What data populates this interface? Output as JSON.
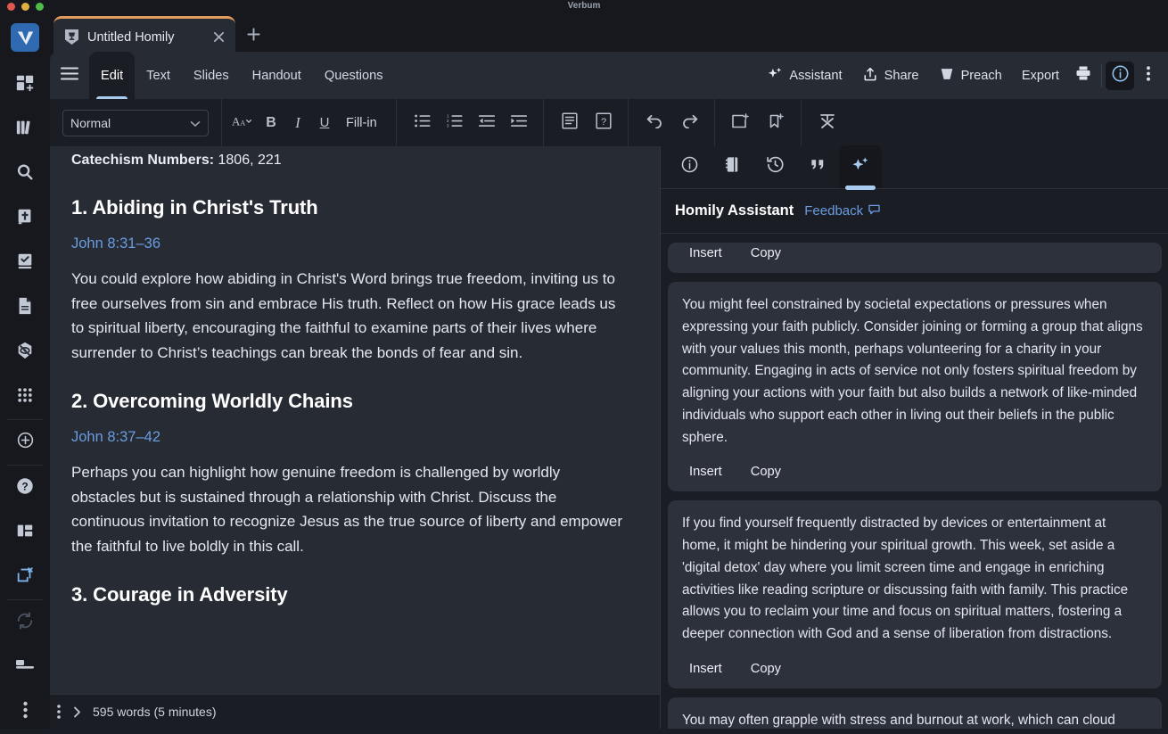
{
  "window": {
    "app_title": "Verbum",
    "traffic_lights": [
      "close-red",
      "minimize-yellow",
      "maximize-green"
    ]
  },
  "tabstrip": {
    "tab_title": "Untitled Homily",
    "tab_icon": "chalice-icon",
    "close_icon": "close-icon",
    "new_tab_icon": "plus-icon",
    "accent": "#e09a5d"
  },
  "sidebar": {
    "items": [
      {
        "name": "verbum-logo",
        "icon": "verbum-logo-icon"
      },
      {
        "name": "new-layout",
        "icon": "add-panel-icon"
      },
      {
        "name": "library",
        "icon": "books-icon"
      },
      {
        "name": "search",
        "icon": "search-icon"
      },
      {
        "name": "bible",
        "icon": "bible-icon"
      },
      {
        "name": "reading-plans",
        "icon": "checkbook-icon"
      },
      {
        "name": "documents",
        "icon": "document-icon"
      },
      {
        "name": "guides",
        "icon": "guide-icon"
      },
      {
        "name": "tools",
        "icon": "grid-apps-icon"
      },
      {
        "name": "add",
        "icon": "plus-circle-icon"
      },
      {
        "name": "help",
        "icon": "question-circle-icon"
      },
      {
        "name": "layouts",
        "icon": "layout-panels-icon"
      },
      {
        "name": "close-layout",
        "icon": "close-layout-icon"
      },
      {
        "name": "sync",
        "icon": "sync-icon"
      },
      {
        "name": "footnote",
        "icon": "footnote-icon"
      },
      {
        "name": "more",
        "icon": "more-vertical-icon"
      }
    ]
  },
  "menubar": {
    "hamburger_icon": "hamburger-icon",
    "tabs": [
      {
        "label": "Edit",
        "active": true
      },
      {
        "label": "Text",
        "active": false
      },
      {
        "label": "Slides",
        "active": false
      },
      {
        "label": "Handout",
        "active": false
      },
      {
        "label": "Questions",
        "active": false
      }
    ],
    "actions": [
      {
        "label": "Assistant",
        "icon": "sparkle-icon"
      },
      {
        "label": "Share",
        "icon": "share-upload-icon"
      },
      {
        "label": "Preach",
        "icon": "pulpit-icon"
      },
      {
        "label": "Export",
        "icon": ""
      }
    ],
    "print_icon": "printer-icon",
    "info_icon": "info-circle-icon",
    "overflow_icon": "more-vertical-icon"
  },
  "formatbar": {
    "style_value": "Normal",
    "style_chevron": "chevron-down-icon",
    "font_size_icon": "font-size-icon",
    "bold": "B",
    "italic": "I",
    "underline": "U",
    "fill_in": "Fill-in",
    "buttons": [
      {
        "name": "bulleted-list",
        "icon": "bulleted-list-icon"
      },
      {
        "name": "numbered-list",
        "icon": "numbered-list-icon"
      },
      {
        "name": "outdent",
        "icon": "outdent-icon"
      },
      {
        "name": "indent",
        "icon": "indent-icon"
      },
      {
        "name": "note",
        "icon": "note-icon"
      },
      {
        "name": "question-box",
        "icon": "question-box-icon"
      },
      {
        "name": "undo",
        "icon": "undo-icon"
      },
      {
        "name": "redo",
        "icon": "redo-icon"
      },
      {
        "name": "add-slide",
        "icon": "add-slide-icon"
      },
      {
        "name": "add-bookmark",
        "icon": "add-bookmark-icon"
      },
      {
        "name": "clear-formatting",
        "icon": "clear-formatting-icon"
      }
    ]
  },
  "document": {
    "catechism_label": "Catechism Numbers:",
    "catechism_value": "1806, 221",
    "sections": [
      {
        "heading": "1. Abiding in Christ's Truth",
        "reference": "John 8:31–36",
        "body": "You could explore how abiding in Christ's Word brings true freedom, inviting us to free ourselves from sin and embrace His truth. Reflect on how His grace leads us to spiritual liberty, encouraging the faithful to examine parts of their lives where surrender to Christ’s teachings can break the bonds of fear and sin."
      },
      {
        "heading": "2. Overcoming Worldly Chains",
        "reference": "John 8:37–42",
        "body": "Perhaps you can highlight how genuine freedom is challenged by worldly obstacles but is sustained through a relationship with Christ. Discuss the continuous invitation to recognize Jesus as the true source of liberty and empower the faithful to live boldly in this call."
      },
      {
        "heading": "3. Courage in Adversity",
        "reference": "",
        "body": ""
      }
    ]
  },
  "statusbar": {
    "more_icon": "more-vertical-icon",
    "expand_icon": "chevron-right-icon",
    "word_count": "595 words (5 minutes)"
  },
  "panel": {
    "tabs": [
      {
        "name": "info",
        "icon": "info-circle-icon",
        "active": false
      },
      {
        "name": "notebook",
        "icon": "notebook-icon",
        "active": false
      },
      {
        "name": "history",
        "icon": "history-clock-icon",
        "active": false
      },
      {
        "name": "quotes",
        "icon": "quote-marks-icon",
        "active": false
      },
      {
        "name": "assistant",
        "icon": "sparkle-icon",
        "active": true
      }
    ],
    "title": "Homily Assistant",
    "feedback_label": "Feedback",
    "feedback_icon": "speech-bubble-icon",
    "insert_label": "Insert",
    "copy_label": "Copy",
    "cards": [
      {
        "text": "",
        "clipped": true
      },
      {
        "text": "You might feel constrained by societal expectations or pressures when expressing your faith publicly. Consider joining or forming a group that aligns with your values this month, perhaps volunteering for a charity in your community. Engaging in acts of service not only fosters spiritual freedom by aligning your actions with your faith but also builds a network of like-minded individuals who support each other in living out their beliefs in the public sphere.",
        "clipped": false
      },
      {
        "text": "If you find yourself frequently distracted by devices or entertainment at home, it might be hindering your spiritual growth. This week, set aside a 'digital detox' day where you limit screen time and engage in enriching activities like reading scripture or discussing faith with family. This practice allows you to reclaim your time and focus on spiritual matters, fostering a deeper connection with God and a sense of liberation from distractions.",
        "clipped": false
      },
      {
        "text": "You may often grapple with stress and burnout at work, which can cloud",
        "clipped": false
      }
    ]
  }
}
